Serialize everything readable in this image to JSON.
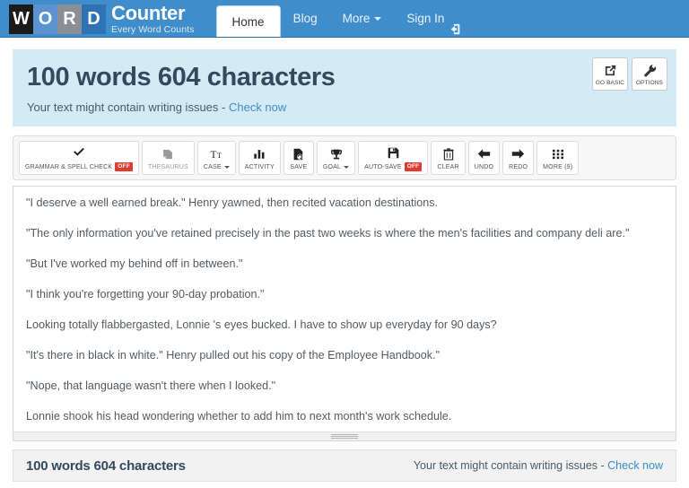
{
  "navbar": {
    "logo_letters": [
      "W",
      "O",
      "R",
      "D"
    ],
    "brand_main": "Counter",
    "brand_sub": "Every Word Counts",
    "items": [
      {
        "label": "Home",
        "active": true,
        "caret": false,
        "icon": null
      },
      {
        "label": "Blog",
        "active": false,
        "caret": false,
        "icon": null
      },
      {
        "label": "More",
        "active": false,
        "caret": true,
        "icon": null
      },
      {
        "label": "Sign In",
        "active": false,
        "caret": false,
        "icon": "sign-in-icon"
      }
    ],
    "nav_color": "#3f8dca"
  },
  "header": {
    "count_title": "100 words 604 characters",
    "issues_text": "Your text might contain writing issues - ",
    "issues_link": "Check now",
    "panel_color": "#d4eaf5",
    "link_color": "#3c8dc5",
    "actions": [
      {
        "label": "GO BASIC",
        "icon": "external-link-icon"
      },
      {
        "label": "OPTIONS",
        "icon": "wrench-icon"
      }
    ]
  },
  "toolbar": {
    "buttons": [
      {
        "label": "GRAMMAR & SPELL CHECK",
        "icon": "check-icon",
        "badge": "OFF",
        "muted": false,
        "caret": false
      },
      {
        "label": "THESAURUS",
        "icon": "book-icon",
        "badge": null,
        "muted": true,
        "caret": false
      },
      {
        "label": "CASE",
        "icon": "text-case-icon",
        "badge": null,
        "muted": false,
        "caret": true
      },
      {
        "label": "ACTIVITY",
        "icon": "bar-chart-icon",
        "badge": null,
        "muted": false,
        "caret": false
      },
      {
        "label": "SAVE",
        "icon": "save-file-icon",
        "badge": null,
        "muted": false,
        "caret": false
      },
      {
        "label": "GOAL",
        "icon": "trophy-icon",
        "badge": null,
        "muted": false,
        "caret": true
      },
      {
        "label": "AUTO-SAVE",
        "icon": "floppy-disk-icon",
        "badge": "OFF",
        "muted": false,
        "caret": false
      },
      {
        "label": "CLEAR",
        "icon": "trash-icon",
        "badge": null,
        "muted": false,
        "caret": false
      },
      {
        "label": "UNDO",
        "icon": "arrow-left-icon",
        "badge": null,
        "muted": false,
        "caret": false
      },
      {
        "label": "REDO",
        "icon": "arrow-right-icon",
        "badge": null,
        "muted": false,
        "caret": false
      },
      {
        "label": "MORE (9)",
        "icon": "grid-icon",
        "badge": null,
        "muted": false,
        "caret": false
      }
    ],
    "badge_color": "#e03b32"
  },
  "editor": {
    "paragraphs": [
      "\"I deserve a well earned break.\" Henry yawned, then recited vacation destinations.",
      "\"The only information you've retained precisely in the past two weeks is where the men's facilities and company deli are.\"",
      "\"But I've worked my behind off in between.\"",
      "\"I think you're forgetting your 90-day probation.\"",
      "Looking totally flabbergasted, Lonnie 's eyes bucked. I have to show up everyday for 90 days?",
      "\"It's there in black in white.\" Henry pulled out his copy of the Employee Handbook.\"",
      "\"Nope, that language wasn't there when I looked.\"",
      "Lonnie shook his head wondering whether to add him to next month's work schedule."
    ]
  },
  "footer": {
    "count_title": "100 words 604 characters",
    "issues_text": "Your text might contain writing issues - ",
    "issues_link": "Check now"
  }
}
